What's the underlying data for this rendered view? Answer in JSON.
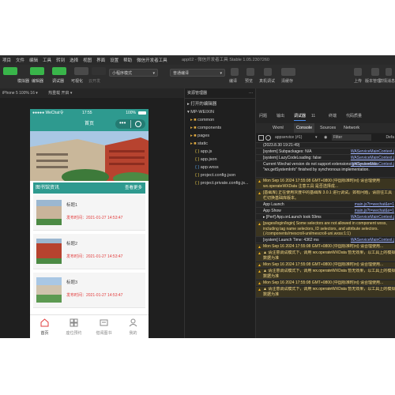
{
  "menu": {
    "items": [
      "项目",
      "文件",
      "编辑",
      "工具",
      "转到",
      "选择",
      "视图",
      "界面",
      "设置",
      "帮助",
      "微信开发者工具"
    ],
    "window_title": "app02 - 微信开发者工具 Stable 1.05.2307260"
  },
  "toolbar": {
    "left_buttons": [
      {
        "label": "模拟器",
        "color": "#39b54a"
      },
      {
        "label": "编辑器",
        "color": "#39b54a"
      },
      {
        "label": "调试器",
        "color": "#39b54a"
      },
      {
        "label": "可视化",
        "color": "#4a4a4a"
      },
      {
        "label": "云开发",
        "color": "#4a4a4a"
      }
    ],
    "mode_select": "小程序模式",
    "compile_select": "普通编译",
    "right_labels": [
      "编译",
      "预览",
      "真机调试",
      "清缓存",
      "上传",
      "版本管理",
      "详情",
      "消息"
    ]
  },
  "simulator": {
    "device": "iPhone 5 100% 16 ▾",
    "hotreload": "热重载 开启 ▾",
    "statusbar": {
      "carrier": "●●●●● WeChat令",
      "time": "17:55",
      "battery": "100%"
    },
    "nav_title": "首页",
    "section_title": "图书馆资讯",
    "section_more": "查看更多",
    "items": [
      {
        "title": "标题1",
        "date": "发布时间：2021-01-27 14:53:47"
      },
      {
        "title": "标题2",
        "date": "发布时间：2021-01-27 14:53:47"
      },
      {
        "title": "标题3",
        "date": "发布时间：2021-01-27 14:53:47"
      }
    ],
    "tabs": [
      {
        "label": "首页",
        "icon": "home-icon"
      },
      {
        "label": "座位预约",
        "icon": "grid-icon"
      },
      {
        "label": "借阅图书",
        "icon": "book-icon"
      },
      {
        "label": "我的",
        "icon": "user-icon"
      }
    ]
  },
  "explorer": {
    "header": "资源管理器",
    "open_editors": "打开的编辑器",
    "project": "MP-WEIXIN",
    "entries": [
      {
        "name": "common",
        "type": "folder"
      },
      {
        "name": "components",
        "type": "folder"
      },
      {
        "name": "pages",
        "type": "folder"
      },
      {
        "name": "static",
        "type": "folder"
      },
      {
        "name": "app.js",
        "type": "js"
      },
      {
        "name": "app.json",
        "type": "json"
      },
      {
        "name": "app.wxss",
        "type": "wxss"
      },
      {
        "name": "project.config.json",
        "type": "json"
      },
      {
        "name": "project.private.config.js...",
        "type": "json"
      }
    ]
  },
  "devtools": {
    "top_tabs": [
      "问题",
      "输出",
      "调试器",
      "11",
      "终端",
      "代码质量"
    ],
    "sub_tabs": [
      "Wxml",
      "Console",
      "Sources",
      "Network"
    ],
    "context": "appservice (#1)",
    "filter": "Filter",
    "default_levels": "Defa",
    "logs": [
      {
        "type": "info",
        "text": "(2023.8.30 19:21:49)"
      },
      {
        "type": "info",
        "text": "[system] Subpackages: N/A",
        "src": "WAServiceMainContext.j"
      },
      {
        "type": "info",
        "text": "[system] LazyCodeLoading: false",
        "src": "WAServiceMainContext.j"
      },
      {
        "type": "info",
        "text": "Current Wechat version do not support extensions getSystemInfo. \"wx.getSystemInfo\" finished by synchronous implementation.",
        "src": "WAServiceMainContext.j"
      },
      {
        "type": "warn",
        "text": "Mon Sep 16 2024 17:55:08 GMT+0800 (中国标准时间) 请合理使用 wx.operateWXData 注意工具 是否选择成..."
      },
      {
        "type": "warn",
        "text": "[基础库] 正在使用灰度中的基础库 3.0.1 进行调试。如有问题，请前往工具栏切换基础库版本。"
      },
      {
        "type": "info",
        "text": "App Launch",
        "src": "main.js?t=wechat&s=1"
      },
      {
        "type": "info",
        "text": "App Show",
        "src": "main.js?t=wechat&s=1"
      },
      {
        "type": "info",
        "text": "▸ [Perf] App.onLaunch took 59ms",
        "src": "WAServiceMainContext.j"
      },
      {
        "type": "warn",
        "text": "[pages/login/login] Some selectors are not allowed in component wxss, including tag name selectors, ID selectors, and attribute selectors.(./components/mescroll-uni/mescroll-uni.wxss:1:1)"
      },
      {
        "type": "info",
        "text": "[system] Launch Time: 4362 ms",
        "src": "WAServiceMainContext.j"
      },
      {
        "type": "warn",
        "text": "Mon Sep 16 2024 17:55:08 GMT+0800 (中国标准时间) 请合理使用..."
      },
      {
        "type": "warn",
        "text": "▲ 请注意调试模式下，调用 wx.operateWXData 暂无效果，以工具上的模拟数据为准"
      },
      {
        "type": "warn",
        "text": "Mon Sep 16 2024 17:55:08 GMT+0800 (中国标准时间) 请合理使用..."
      },
      {
        "type": "warn",
        "text": "▲ 请注意调试模式下，调用 wx.operateWXData 暂无效果，以工具上的模拟数据为准"
      },
      {
        "type": "warn",
        "text": "Mon Sep 16 2024 17:55:08 GMT+0800 (中国标准时间) 请合理使用..."
      },
      {
        "type": "warn",
        "text": "▲ 请注意调试模式下，调用 wx.operateWXData 暂无效果，以工具上的模拟数据为准"
      }
    ]
  },
  "colors": {
    "accent": "#2e9a8f",
    "green": "#39b54a",
    "date_red": "#e23c3c"
  }
}
